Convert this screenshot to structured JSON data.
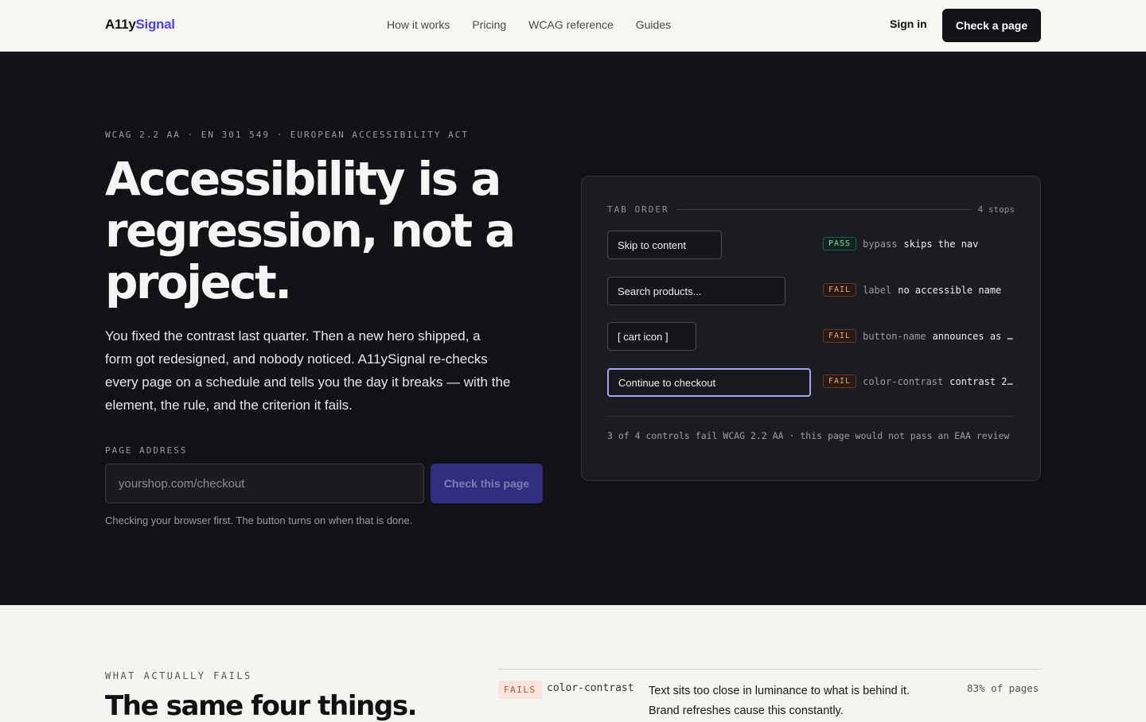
{
  "header": {
    "brand_prefix": "A11y",
    "brand_accent": "Signal",
    "nav": [
      "How it works",
      "Pricing",
      "WCAG reference",
      "Guides"
    ],
    "sign_in": "Sign in",
    "cta": "Check a page"
  },
  "hero": {
    "eyebrow": "WCAG 2.2 AA · EN 301 549 · EUROPEAN ACCESSIBILITY ACT",
    "headline": "Accessibility is a regression, not a project.",
    "lede": "You fixed the contrast last quarter. Then a new hero shipped, a form got redesigned, and nobody noticed. A11ySignal re-checks every page on a schedule and tells you the day it breaks — with the element, the rule, and the criterion it fails.",
    "field_label": "PAGE ADDRESS",
    "input_placeholder": "yourshop.com/checkout",
    "button": "Check this page",
    "hint": "Checking your browser first. The button turns on when that is done."
  },
  "tab_card": {
    "title": "TAB ORDER",
    "count": "4 stops",
    "stops": [
      {
        "label": "Skip to content",
        "status": "PASS",
        "rule": "bypass",
        "message": "skips the nav"
      },
      {
        "label": "Search products...",
        "status": "FAIL",
        "rule": "label",
        "message": "no accessible name"
      },
      {
        "label": "[ cart icon ]",
        "status": "FAIL",
        "rule": "button-name",
        "message": "announces as …"
      },
      {
        "label": "Continue to checkout",
        "status": "FAIL",
        "rule": "color-contrast",
        "message": "contrast 2…"
      }
    ],
    "footer": "3 of 4 controls fail WCAG 2.2 AA · this page would not pass an EAA review"
  },
  "lower": {
    "eyebrow": "WHAT ACTUALLY FAILS",
    "title": "The same four things.",
    "first_item": {
      "badge": "FAILS",
      "name": "color-contrast",
      "description": "Text sits too close in luminance to what is behind it. Brand refreshes cause this constantly.",
      "stat": "83% of pages"
    }
  },
  "colors": {
    "accent": "#4f46e5",
    "hero_bg": "#121317",
    "pass": "#6ee7b7",
    "fail": "#f0a276",
    "focus_ring": "#a8a5f5"
  }
}
